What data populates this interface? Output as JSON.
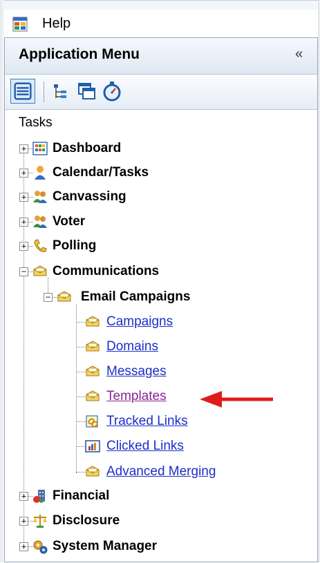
{
  "menubar": {
    "app_icon": "app-window-icon",
    "help_label": "Help"
  },
  "panel": {
    "title": "Application Menu",
    "collapse_glyph": "«",
    "toolbar": [
      "list-view-icon",
      "tree-view-icon",
      "windows-icon",
      "stopwatch-icon"
    ]
  },
  "tasks_label": "Tasks",
  "tree": {
    "dashboard": {
      "label": "Dashboard",
      "icon": "dashboard-icon"
    },
    "calendar": {
      "label": "Calendar/Tasks",
      "icon": "person-icon"
    },
    "canvassing": {
      "label": "Canvassing",
      "icon": "people-icon"
    },
    "voter": {
      "label": "Voter",
      "icon": "people-icon"
    },
    "polling": {
      "label": "Polling",
      "icon": "phone-icon"
    },
    "communications": {
      "label": "Communications",
      "icon": "envelopes-icon"
    },
    "email_campaigns": {
      "label": "Email Campaigns",
      "icon": "envelopes-icon"
    },
    "campaigns": {
      "label": "Campaigns"
    },
    "domains": {
      "label": "Domains"
    },
    "messages": {
      "label": "Messages"
    },
    "templates": {
      "label": "Templates"
    },
    "tracked_links": {
      "label": "Tracked Links"
    },
    "clicked_links": {
      "label": "Clicked Links"
    },
    "advanced_merging": {
      "label": "Advanced Merging"
    },
    "financial": {
      "label": "Financial",
      "icon": "financial-icon"
    },
    "disclosure": {
      "label": "Disclosure",
      "icon": "scales-icon"
    },
    "system_manager": {
      "label": "System Manager",
      "icon": "gears-icon"
    }
  },
  "colors": {
    "link": "#1a2ec8",
    "visited_link": "#8a2398",
    "arrow": "#e01b1b"
  }
}
